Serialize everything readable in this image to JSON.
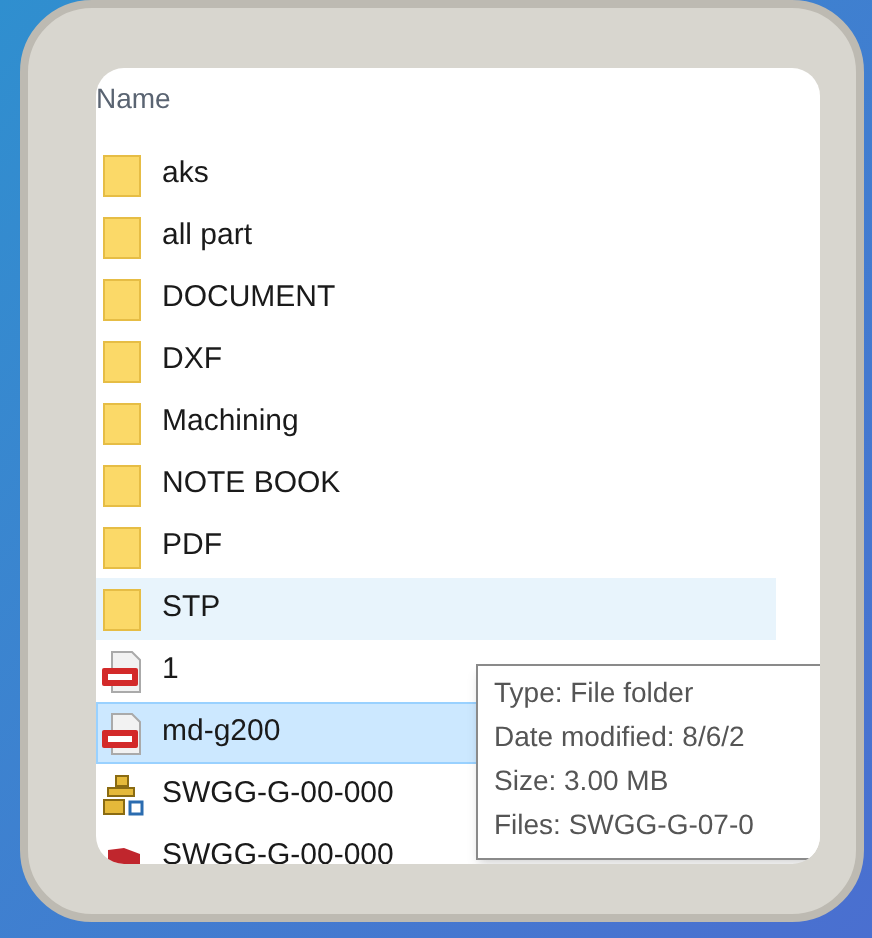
{
  "header": {
    "column_1": "Name"
  },
  "rows": [
    {
      "name": "aks",
      "kind": "folder",
      "selected": false,
      "hovered": false
    },
    {
      "name": "all part",
      "kind": "folder",
      "selected": false,
      "hovered": false
    },
    {
      "name": "DOCUMENT",
      "kind": "folder",
      "selected": false,
      "hovered": false
    },
    {
      "name": "DXF",
      "kind": "folder",
      "selected": false,
      "hovered": false
    },
    {
      "name": "Machining",
      "kind": "folder",
      "selected": false,
      "hovered": false
    },
    {
      "name": "NOTE BOOK",
      "kind": "folder",
      "selected": false,
      "hovered": false
    },
    {
      "name": "PDF",
      "kind": "folder",
      "selected": false,
      "hovered": false
    },
    {
      "name": "STP",
      "kind": "folder",
      "selected": false,
      "hovered": true
    },
    {
      "name": "1",
      "kind": "pdf",
      "selected": false,
      "hovered": false
    },
    {
      "name": "md-g200",
      "kind": "pdf",
      "selected": true,
      "hovered": false
    },
    {
      "name": "SWGG-G-00-000",
      "kind": "assembly",
      "selected": false,
      "hovered": false
    },
    {
      "name": "SWGG-G-00-000",
      "kind": "part",
      "selected": false,
      "hovered": false
    }
  ],
  "tooltip": {
    "lines": [
      "Type: File folder",
      "Date modified: 8/6/2",
      "Size: 3.00 MB",
      "Files: SWGG-G-07-0"
    ]
  }
}
